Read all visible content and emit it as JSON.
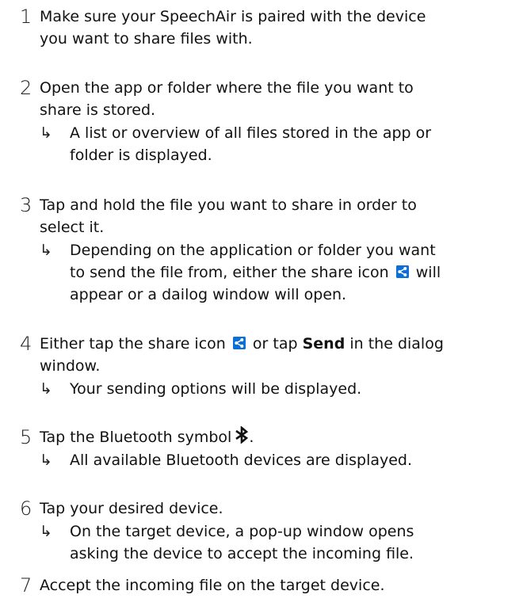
{
  "steps": [
    {
      "number": "1",
      "line1": "Make sure your SpeechAir is paired with the device",
      "line2": "you want to share files with."
    },
    {
      "number": "2",
      "line1": "Open the app or folder where the file you want to",
      "line2": "share is stored.",
      "result_line1": "A list or overview of all files stored in the app or",
      "result_line2": "folder is displayed."
    },
    {
      "number": "3",
      "line1": "Tap and hold the file you want to share in order to",
      "line2": "select it.",
      "result_line1": "Depending on the application or folder you want",
      "result_line2_a": "to send the file from, either the share icon",
      "result_line2_b": "will",
      "result_line3": "appear or a dailog window will open."
    },
    {
      "number": "4",
      "line1_a": "Either tap the share icon",
      "line1_b": "or tap",
      "line1_bold": "Send",
      "line1_c": "in the dialog",
      "line2": "window.",
      "result_line1": "Your sending options will be displayed."
    },
    {
      "number": "5",
      "line1": "Tap the Bluetooth symbol",
      "line1_end": ".",
      "result_line1": "All available Bluetooth devices are displayed."
    },
    {
      "number": "6",
      "line1": "Tap your desired device.",
      "result_line1": "On the target device, a pop-up window opens",
      "result_line2": "asking the device to accept the incoming file."
    },
    {
      "number": "7",
      "line1": "Accept the incoming file on the target device."
    }
  ],
  "result_arrow": "↳",
  "icons": {
    "share": "share-icon",
    "bluetooth": "bluetooth-icon",
    "share_color": "#0a6fd6"
  }
}
